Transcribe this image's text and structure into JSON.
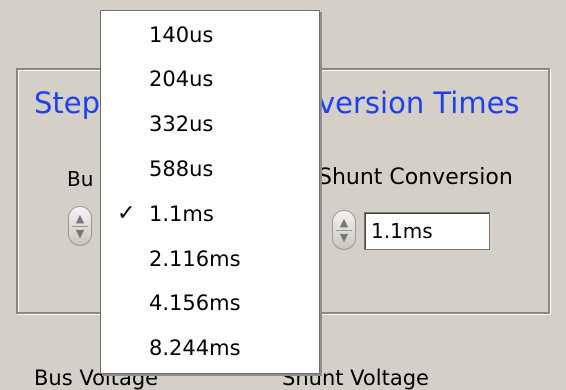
{
  "group": {
    "title_left": "Step",
    "title_right": "version Times"
  },
  "bus": {
    "label_fragment": "Bu"
  },
  "shunt": {
    "label": "Shunt Conversion",
    "value": "1.1ms"
  },
  "dropdown": {
    "items": [
      {
        "label": "140us",
        "checked": false
      },
      {
        "label": "204us",
        "checked": false
      },
      {
        "label": "332us",
        "checked": false
      },
      {
        "label": "588us",
        "checked": false
      },
      {
        "label": "1.1ms",
        "checked": true
      },
      {
        "label": "2.116ms",
        "checked": false
      },
      {
        "label": "4.156ms",
        "checked": false
      },
      {
        "label": "8.244ms",
        "checked": false
      }
    ],
    "check_mark": "✓"
  },
  "bottom": {
    "bus_voltage": "Bus Voltage",
    "shunt_voltage": "Shunt Voltage"
  },
  "colors": {
    "title_blue": "#1d3ff0",
    "panel_gray": "#d4d0c8"
  }
}
